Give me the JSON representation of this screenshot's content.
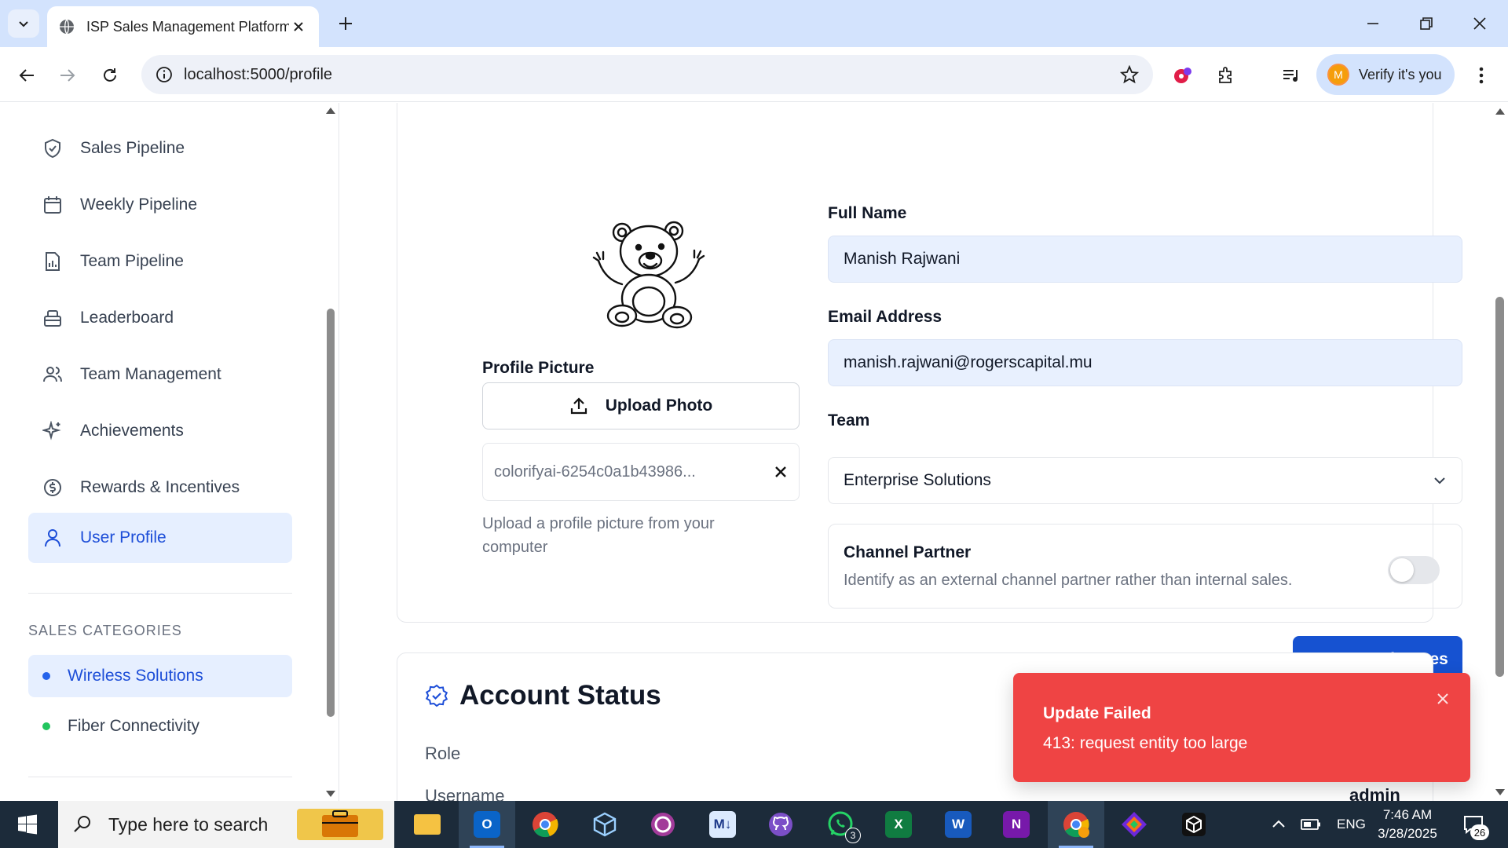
{
  "browser": {
    "tab_title": "ISP Sales Management Platform",
    "url": "localhost:5000/profile",
    "profile_initial": "M",
    "profile_label": "Verify it's you"
  },
  "sidebar": {
    "items": [
      {
        "label": "Sales Pipeline",
        "icon": "shield-icon"
      },
      {
        "label": "Weekly Pipeline",
        "icon": "calendar-icon"
      },
      {
        "label": "Team Pipeline",
        "icon": "file-chart-icon"
      },
      {
        "label": "Leaderboard",
        "icon": "trophy-icon"
      },
      {
        "label": "Team Management",
        "icon": "users-icon"
      },
      {
        "label": "Achievements",
        "icon": "sparkles-icon"
      },
      {
        "label": "Rewards & Incentives",
        "icon": "dollar-circle-icon"
      },
      {
        "label": "User Profile",
        "icon": "user-icon",
        "active": true
      }
    ],
    "section_title": "SALES CATEGORIES",
    "categories": [
      {
        "label": "Wireless Solutions",
        "color": "#2563eb",
        "active": true
      },
      {
        "label": "Fiber Connectivity",
        "color": "#22c55e"
      }
    ]
  },
  "profile": {
    "picture_label": "Profile Picture",
    "upload_label": "Upload Photo",
    "file_name": "colorifyai-6254c0a1b43986...",
    "help_text": "Upload a profile picture from your computer",
    "full_name_label": "Full Name",
    "full_name": "Manish Rajwani",
    "email_label": "Email Address",
    "email": "manish.rajwani@rogerscapital.mu",
    "team_label": "Team",
    "team": "Enterprise Solutions",
    "partner_title": "Channel Partner",
    "partner_desc": "Identify as an external channel partner rather than internal sales.",
    "partner_enabled": false,
    "save_label": "Save Changes"
  },
  "account_status": {
    "title": "Account Status",
    "role_label": "Role",
    "username_label": "Username",
    "username_value": "admin"
  },
  "toast": {
    "title": "Update Failed",
    "message": "413: request entity too large"
  },
  "taskbar": {
    "search_placeholder": "Type here to search",
    "whatsapp_badge": "3",
    "language": "ENG",
    "time": "7:46 AM",
    "date": "3/28/2025",
    "notifications": "26"
  },
  "colors": {
    "accent": "#1652d1",
    "active_bg": "#e6efff",
    "toast": "#ef4444"
  }
}
